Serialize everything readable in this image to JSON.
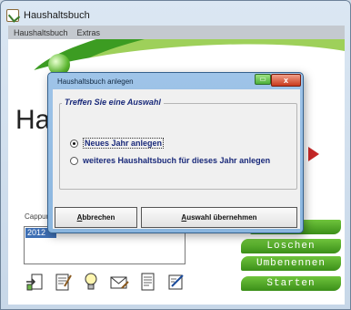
{
  "window": {
    "title": "Haushaltsbuch",
    "menu": [
      "Haushaltsbuch",
      "Extras"
    ]
  },
  "main": {
    "big_title": "Hau",
    "list_label": "Cappunt",
    "years": [
      "2012"
    ],
    "buttons": {
      "loeschen": "Loschen",
      "umbenennen": "Umbenennen",
      "starten": "Starten"
    },
    "toolbar_icons": [
      "import-icon",
      "notepad-icon",
      "lightbulb-icon",
      "mail-icon",
      "document-icon",
      "edit-icon"
    ]
  },
  "dialog": {
    "title": "Haushaltsbuch anlegen",
    "group_title": "Treffen Sie eine Auswahl",
    "options": [
      {
        "label": "Neues Jahr anlegen",
        "selected": true
      },
      {
        "label": "weiteres Haushaltsbuch für dieses Jahr anlegen",
        "selected": false
      }
    ],
    "cancel_label": "Abbrechen",
    "accept_label": "Auswahl übernehmen",
    "close_glyph": "x",
    "minimize_glyph": "▭"
  },
  "colors": {
    "accent_green": "#3b8f19",
    "dialog_frame": "#8ab5de",
    "close_red": "#c93a1c"
  }
}
